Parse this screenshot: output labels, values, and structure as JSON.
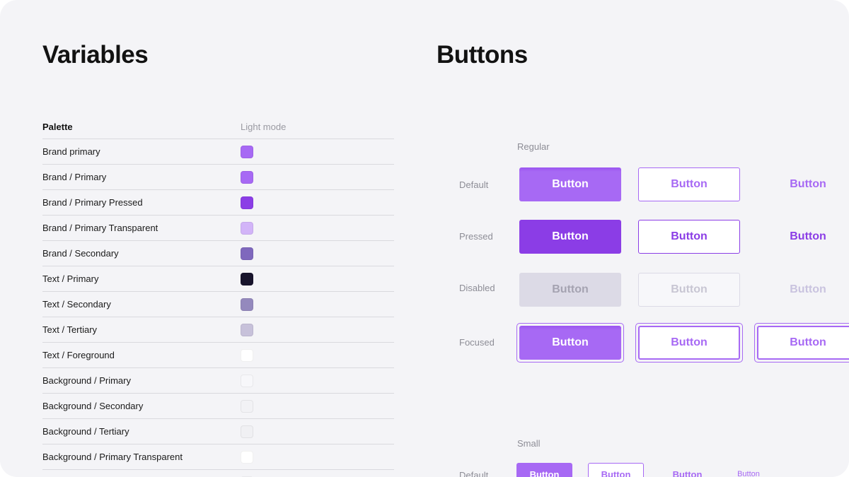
{
  "variables": {
    "title": "Variables",
    "header": {
      "name": "Palette",
      "mode": "Light mode"
    },
    "rows": [
      {
        "name": "Brand primary",
        "color": "#a769f4"
      },
      {
        "name": "Brand / Primary",
        "color": "#a769f4"
      },
      {
        "name": "Brand / Primary Pressed",
        "color": "#8b3de6"
      },
      {
        "name": "Brand / Primary Transparent",
        "color": "#d2b4f8"
      },
      {
        "name": "Brand / Secondary",
        "color": "#7f68bd"
      },
      {
        "name": "Text / Primary",
        "color": "#18142c"
      },
      {
        "name": "Text / Secondary",
        "color": "#9489bd"
      },
      {
        "name": "Text / Tertiary",
        "color": "#c7c1da"
      },
      {
        "name": "Text / Foreground",
        "color": "#ffffff"
      },
      {
        "name": "Background / Primary",
        "color": "#f7f7fa"
      },
      {
        "name": "Background / Secondary",
        "color": "#f2f2f5"
      },
      {
        "name": "Background / Tertiary",
        "color": "#f0f0f3"
      },
      {
        "name": "Background / Primary Transparent",
        "color": "#ffffff"
      },
      {
        "name": "",
        "color": "#f7f7fa"
      }
    ]
  },
  "buttons": {
    "title": "Buttons",
    "regular_label": "Regular",
    "small_label": "Small",
    "states": {
      "default": "Default",
      "pressed": "Pressed",
      "disabled": "Disabled",
      "focused": "Focused"
    },
    "button_label": "Button",
    "colors": {
      "primary": "#a769f4",
      "pressed": "#8b3de6",
      "disabled_bg": "#dcdae6",
      "disabled_text": "#a5a3b1",
      "disabled_outline_text": "#c8c6d3",
      "disabled_ghost_text": "#c9c3df",
      "ring": "#a769f4"
    }
  }
}
